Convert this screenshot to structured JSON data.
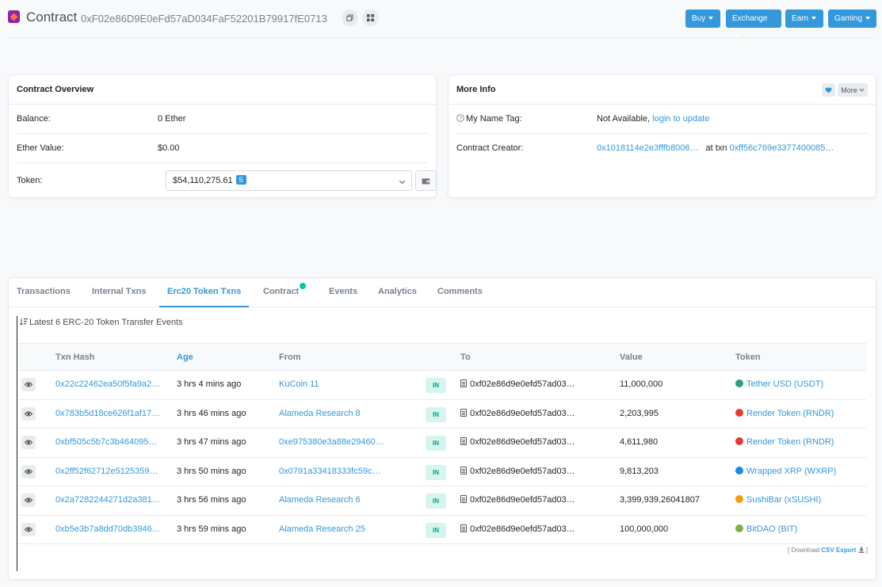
{
  "header": {
    "title": "Contract",
    "address": "0xF02e86D9E0eFd57aD034FaF52201B79917fE0713",
    "nav": [
      "Buy",
      "Exchange",
      "Earn",
      "Gaming"
    ],
    "icons": [
      "copy-icon",
      "qr-code-icon"
    ]
  },
  "overview": {
    "title": "Contract Overview",
    "balance_label": "Balance:",
    "balance_value": "0 Ether",
    "ether_value_label": "Ether Value:",
    "ether_value": "$0.00",
    "token_label": "Token:",
    "token_value": "$54,110,275.61",
    "token_count": "5"
  },
  "more_info": {
    "title": "More Info",
    "more_label": "More",
    "name_tag_label": "My Name Tag:",
    "name_tag_value": "Not Available,",
    "name_tag_link": "login to update",
    "creator_label": "Contract Creator:",
    "creator_address": "0x1018114e2e3fffb8006…",
    "creator_at": "at txn",
    "creator_txn": "0xff56c769e3377400085…"
  },
  "tabs": [
    "Transactions",
    "Internal Txns",
    "Erc20 Token Txns",
    "Contract",
    "Events",
    "Analytics",
    "Comments"
  ],
  "active_tab": "Erc20 Token Txns",
  "table": {
    "title": "Latest 6 ERC-20 Token Transfer Events",
    "columns": [
      "Txn Hash",
      "Age",
      "From",
      "To",
      "Value",
      "Token"
    ],
    "direction_label": "IN",
    "rows": [
      {
        "hash": "0x22c22462ea50f5fa9a2…",
        "age": "3 hrs 4 mins ago",
        "from": "KuCoin 11",
        "to": "0xf02e86d9e0efd57ad03…",
        "value": "11,000,000",
        "token": "Tether USD (USDT)",
        "token_color": "#26a17b"
      },
      {
        "hash": "0x783b5d18ce626f1af17…",
        "age": "3 hrs 46 mins ago",
        "from": "Alameda Research 8",
        "to": "0xf02e86d9e0efd57ad03…",
        "value": "2,203,995",
        "token": "Render Token (RNDR)",
        "token_color": "#e53935"
      },
      {
        "hash": "0xbf505c5b7c3b464095…",
        "age": "3 hrs 47 mins ago",
        "from": "0xe975380e3a88e29460…",
        "to": "0xf02e86d9e0efd57ad03…",
        "value": "4,611,980",
        "token": "Render Token (RNDR)",
        "token_color": "#e53935"
      },
      {
        "hash": "0x2ff52f62712e5125359…",
        "age": "3 hrs 50 mins ago",
        "from": "0x0791a33418333fc59c…",
        "to": "0xf02e86d9e0efd57ad03…",
        "value": "9,813,203",
        "token": "Wrapped XRP (WXRP)",
        "token_color": "#1e88e5"
      },
      {
        "hash": "0x2a7282244271d2a381…",
        "age": "3 hrs 56 mins ago",
        "from": "Alameda Research 6",
        "to": "0xf02e86d9e0efd57ad03…",
        "value": "3,399,939.26041807",
        "token": "SushiBar (xSUSHI)",
        "token_color": "#f59e0b"
      },
      {
        "hash": "0xb5e3b7a8dd70db3946…",
        "age": "3 hrs 59 mins ago",
        "from": "Alameda Research 25",
        "to": "0xf02e86d9e0efd57ad03…",
        "value": "100,000,000",
        "token": "BitDAO (BIT)",
        "token_color": "#7cb342"
      }
    ],
    "download_prefix": "[ Download",
    "download_link": "CSV Export",
    "download_suffix": "]"
  }
}
